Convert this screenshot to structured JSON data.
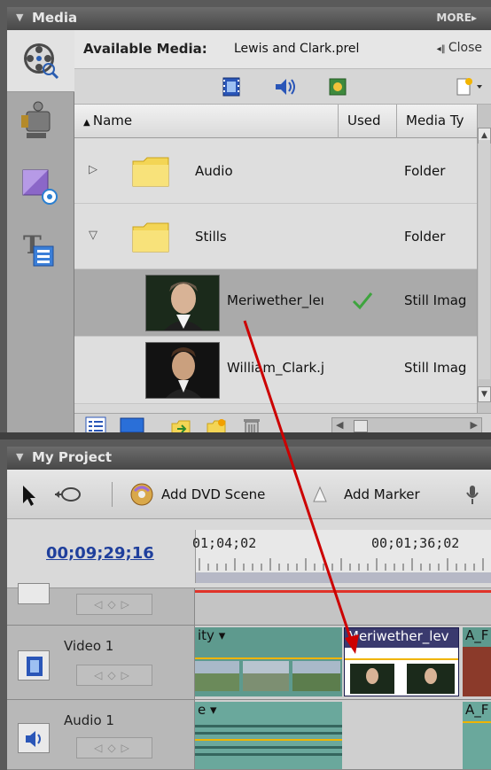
{
  "media_panel": {
    "title": "Media",
    "more": "MORE▸",
    "available_label": "Available Media:",
    "project_name": "Lewis and Clark.prel",
    "close_label": "Close",
    "columns": {
      "name": "Name",
      "used": "Used",
      "type": "Media Ty"
    },
    "rows": [
      {
        "name": "Audio",
        "type": "Folder",
        "expanded": false
      },
      {
        "name": "Stills",
        "type": "Folder",
        "expanded": true
      },
      {
        "name": "Meriwether_leı",
        "type": "Still Imag",
        "used": true,
        "selected": true
      },
      {
        "name": "William_Clark.j",
        "type": "Still Imag",
        "used": false,
        "selected": false
      }
    ]
  },
  "project_panel": {
    "title": "My Project",
    "add_dvd_scene": "Add DVD Scene",
    "add_marker": "Add Marker",
    "timecode": "00;09;29;16",
    "ruler_labels": [
      "01;04;02",
      "00;01;36;02"
    ],
    "tracks": {
      "video1": {
        "name": "Video 1",
        "clips": [
          {
            "title": "ity ▾"
          },
          {
            "title": "Meriwether_lev"
          },
          {
            "title": "A_F"
          }
        ]
      },
      "audio1": {
        "name": "Audio 1",
        "clips": [
          {
            "title": "e ▾"
          },
          {
            "title": "A_F"
          }
        ]
      }
    }
  },
  "colors": {
    "drag_arrow": "#cc0000",
    "timecode": "#1f3f9c",
    "selected_clip_header": "#3a3a6e"
  }
}
